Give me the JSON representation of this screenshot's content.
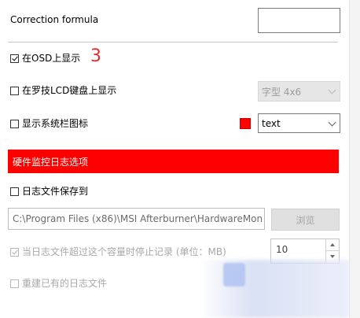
{
  "correction": {
    "label": "Correction formula",
    "value": ""
  },
  "annotation": "3",
  "osd": {
    "label": "在OSD上显示",
    "checked": true
  },
  "lcd": {
    "label": "在罗技LCD键盘上显示",
    "checked": false,
    "font_select": "字型 4x6"
  },
  "tray": {
    "label": "显示系统栏图标",
    "checked": false,
    "color": "#ff0000",
    "mode_select": "text"
  },
  "section": {
    "title": "硬件监控日志选项",
    "color": "#ff0000"
  },
  "log_save": {
    "label": "日志文件保存到",
    "checked": false
  },
  "log_path": {
    "value": "C:\\Program Files (x86)\\MSI Afterburner\\HardwareMon"
  },
  "browse": {
    "label": "浏览"
  },
  "limit": {
    "label": "当日志文件超过这个容量时停止记录 (单位：MB)",
    "checked": true,
    "value": "10"
  },
  "recreate": {
    "label": "重建已有的日志文件",
    "checked": false
  }
}
